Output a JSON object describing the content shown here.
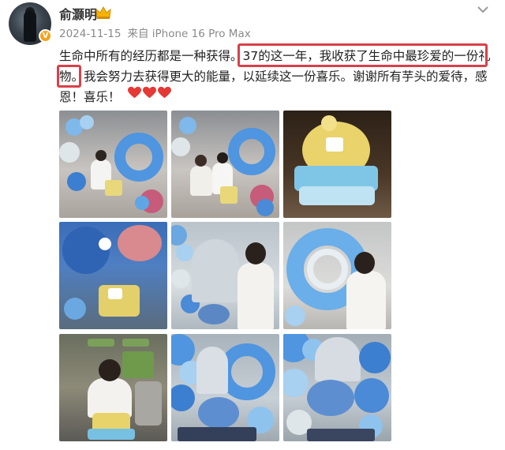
{
  "header": {
    "username": "俞灏明",
    "date": "2024-11-15",
    "source": "来自 iPhone 16 Pro Max",
    "verified_badge": "V"
  },
  "post": {
    "segments": [
      {
        "text": "生命中所有的经历都是一种获得。",
        "highlight": false
      },
      {
        "text": "37的这一年，我收获了生命中最珍爱的一份礼物。",
        "highlight": true
      },
      {
        "text": "我会努力去获得更大的能量，以延续这一份喜乐。谢谢所有芋头的爱待，感恩！喜乐！",
        "highlight": false
      }
    ],
    "emoji": [
      "heart-icon",
      "heart-icon",
      "heart-icon"
    ]
  },
  "photos": [
    {
      "name": "photo-1",
      "scene": "balloon-party-seated"
    },
    {
      "name": "photo-2",
      "scene": "balloon-party-two-people"
    },
    {
      "name": "photo-3",
      "scene": "cake-topdown"
    },
    {
      "name": "photo-4",
      "scene": "flowers-and-cake"
    },
    {
      "name": "photo-5",
      "scene": "man-by-backdrop"
    },
    {
      "name": "photo-6",
      "scene": "balloon-ring-man"
    },
    {
      "name": "photo-7",
      "scene": "man-making-wish"
    },
    {
      "name": "photo-8",
      "scene": "balloon-arch"
    },
    {
      "name": "photo-9",
      "scene": "balloon-arch-closeup"
    }
  ],
  "colors": {
    "highlight_border": "#d9404a",
    "balloon_blue": "#5fa6e6",
    "balloon_light": "#b9dcf5",
    "heart_red": "#e53935",
    "badge_orange": "#f7a21b"
  }
}
